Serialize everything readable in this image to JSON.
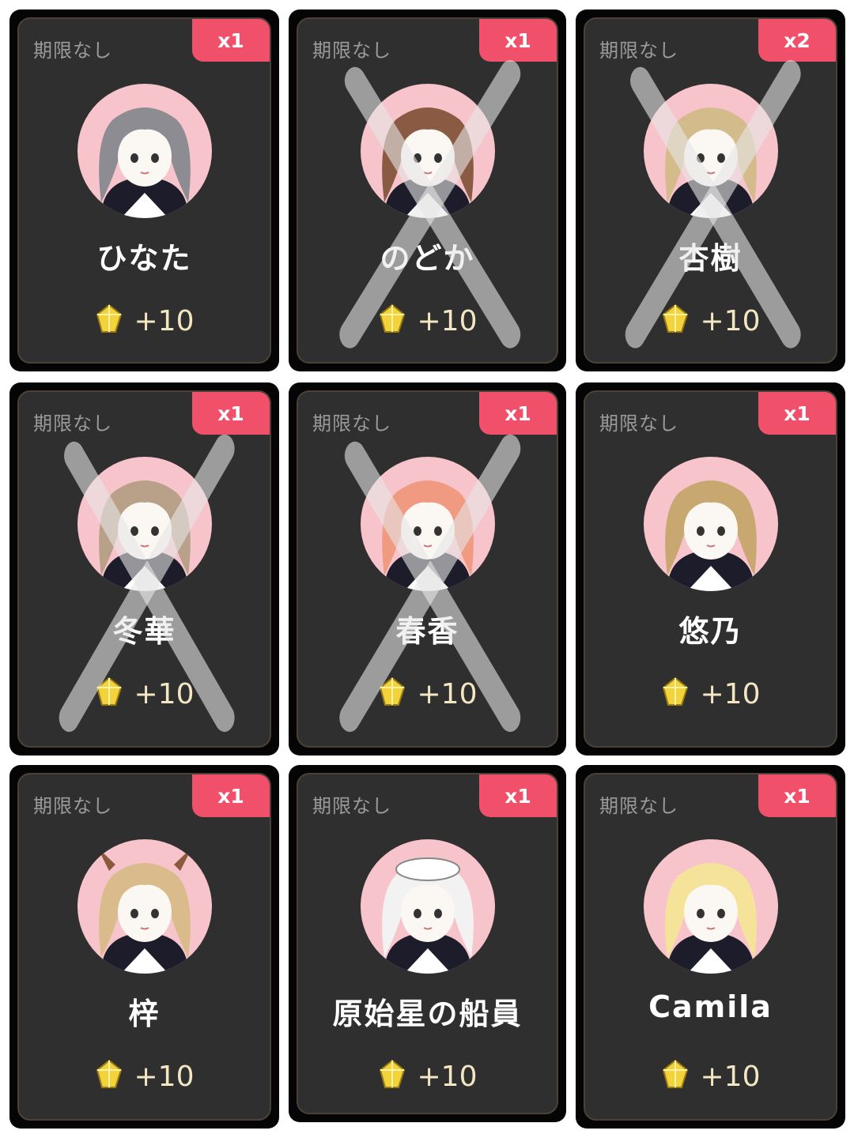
{
  "cards": [
    {
      "expiry": "期限なし",
      "count": "x1",
      "name": "ひなた",
      "reward": "+10",
      "hair": "#8c8c92",
      "crossed": false
    },
    {
      "expiry": "期限なし",
      "count": "x1",
      "name": "のどか",
      "reward": "+10",
      "hair": "#8a5a43",
      "crossed": true
    },
    {
      "expiry": "期限なし",
      "count": "x2",
      "name": "杏樹",
      "reward": "+10",
      "hair": "#d3bb8c",
      "crossed": true
    },
    {
      "expiry": "期限なし",
      "count": "x1",
      "name": "冬華",
      "reward": "+10",
      "hair": "#b9a089",
      "crossed": true
    },
    {
      "expiry": "期限なし",
      "count": "x1",
      "name": "春香",
      "reward": "+10",
      "hair": "#f19a82",
      "crossed": true
    },
    {
      "expiry": "期限なし",
      "count": "x1",
      "name": "悠乃",
      "reward": "+10",
      "hair": "#c8a870",
      "crossed": false
    },
    {
      "expiry": "期限なし",
      "count": "x1",
      "name": "梓",
      "reward": "+10",
      "hair": "#d9bb8c",
      "crossed": false
    },
    {
      "expiry": "期限なし",
      "count": "x1",
      "name": "原始星の船員",
      "reward": "+10",
      "hair": "#f2f2f2",
      "crossed": false
    },
    {
      "expiry": "期限なし",
      "count": "x1",
      "name": "Camila",
      "reward": "+10",
      "hair": "#f6e39a",
      "crossed": false
    }
  ],
  "icons": {
    "reward": "gold-crystal-icon"
  },
  "colors": {
    "badge": "#f0506a",
    "card": "#2f2f2f",
    "avatar_bg": "#f7c4cb"
  }
}
